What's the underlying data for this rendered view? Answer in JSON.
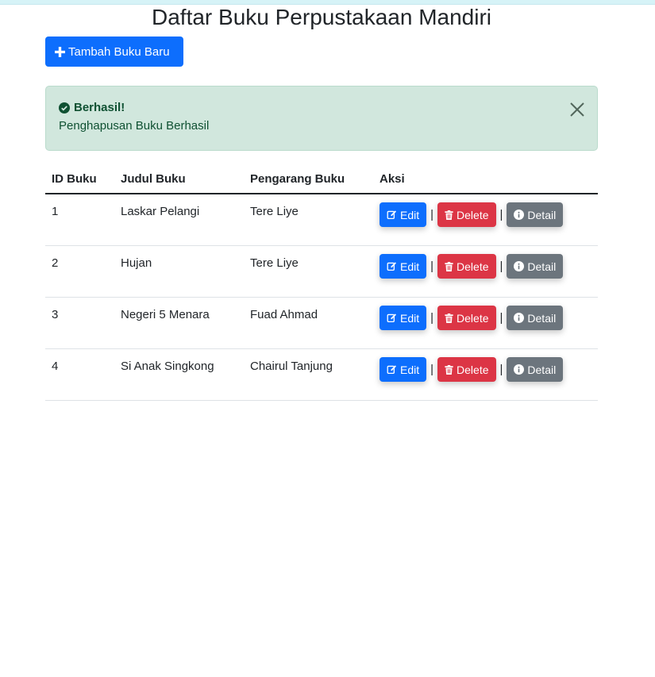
{
  "page": {
    "title": "Daftar Buku Perpustakaan Mandiri"
  },
  "toolbar": {
    "add_label": "Tambah Buku Baru",
    "add_icon": "plus-icon"
  },
  "alert": {
    "title": "Berhasil!",
    "message": "Penghapusan Buku Berhasil",
    "icon": "check-circle-icon",
    "color": "#0f5132",
    "background": "#d1e7dd"
  },
  "table": {
    "headers": [
      "ID Buku",
      "Judul Buku",
      "Pengarang Buku",
      "Aksi"
    ],
    "rows": [
      {
        "id": "1",
        "title": "Laskar Pelangi",
        "author": "Tere Liye"
      },
      {
        "id": "2",
        "title": "Hujan",
        "author": "Tere Liye"
      },
      {
        "id": "3",
        "title": "Negeri 5 Menara",
        "author": "Fuad Ahmad"
      },
      {
        "id": "4",
        "title": "Si Anak Singkong",
        "author": "Chairul Tanjung"
      }
    ]
  },
  "actions": {
    "edit_label": "Edit",
    "delete_label": "Delete",
    "detail_label": "Detail",
    "separator": "|"
  },
  "colors": {
    "primary": "#0d6efd",
    "danger": "#dc3545",
    "secondary": "#6c757d"
  }
}
